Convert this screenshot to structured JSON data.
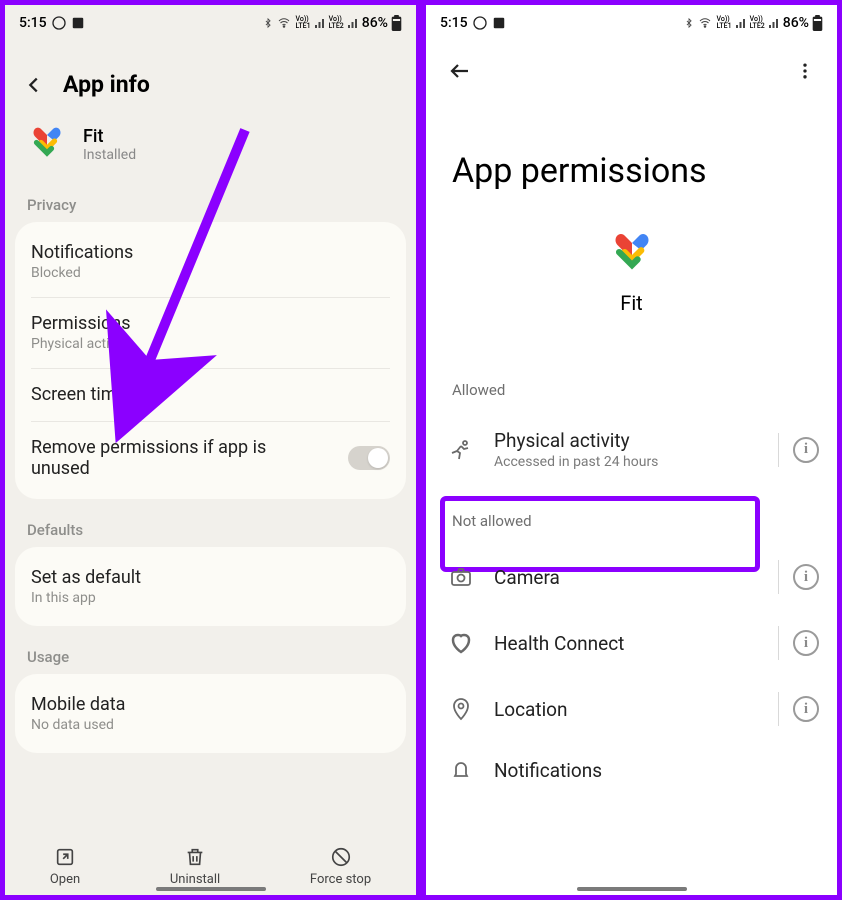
{
  "status": {
    "time": "5:15",
    "battery": "86%"
  },
  "left": {
    "title": "App info",
    "app": {
      "name": "Fit",
      "status": "Installed"
    },
    "sections": {
      "privacy": "Privacy",
      "defaults": "Defaults",
      "usage": "Usage"
    },
    "rows": {
      "notifications": {
        "title": "Notifications",
        "sub": "Blocked"
      },
      "permissions": {
        "title": "Permissions",
        "sub": "Physical activity"
      },
      "screen_time": {
        "title": "Screen time"
      },
      "remove_perm": {
        "title": "Remove permissions if app is unused"
      },
      "set_default": {
        "title": "Set as default",
        "sub": "In this app"
      },
      "mobile_data": {
        "title": "Mobile data",
        "sub": "No data used"
      }
    },
    "actions": {
      "open": "Open",
      "uninstall": "Uninstall",
      "force_stop": "Force stop"
    }
  },
  "right": {
    "title": "App permissions",
    "app_name": "Fit",
    "allowed_label": "Allowed",
    "not_allowed_label": "Not allowed",
    "perms": {
      "physical": {
        "name": "Physical activity",
        "sub": "Accessed in past 24 hours"
      },
      "camera": {
        "name": "Camera"
      },
      "health": {
        "name": "Health Connect"
      },
      "location": {
        "name": "Location"
      },
      "notifications": {
        "name": "Notifications"
      }
    }
  }
}
